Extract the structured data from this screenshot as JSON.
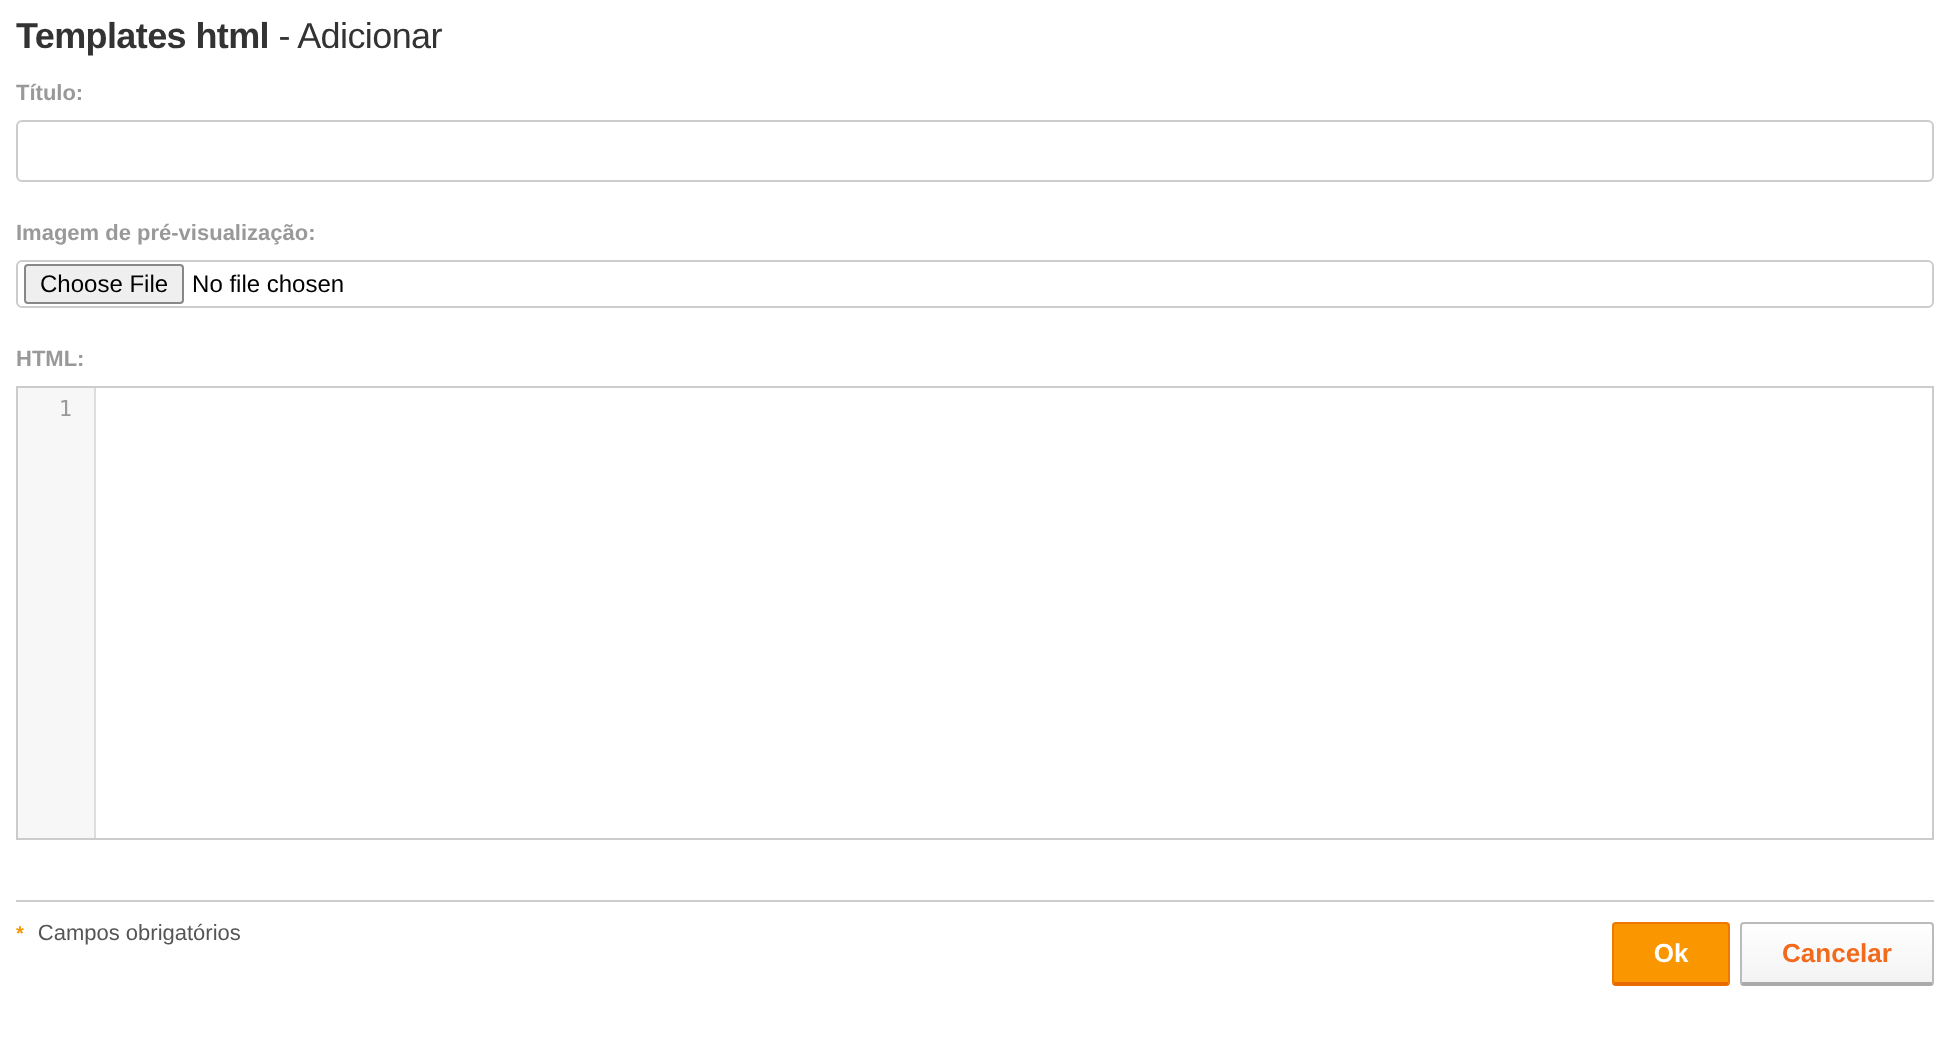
{
  "page_title": "**Templates html** - Adicionar",
  "fields": [
    {
      "kind": "text",
      "label": "Título:"
    },
    {
      "kind": "file",
      "label": "Imagem de pré-visualização:",
      "button": "Choose File",
      "status": "No file chosen"
    },
    {
      "kind": "code",
      "label": "HTML:",
      "line_numbers": [
        "1"
      ]
    }
  ],
  "footer": {
    "marker": "*",
    "note": "Campos obrigatórios",
    "buttons": [
      {
        "label": "Ok",
        "kind": "primary"
      },
      {
        "label": "Cancelar",
        "kind": "secondary"
      }
    ]
  }
}
